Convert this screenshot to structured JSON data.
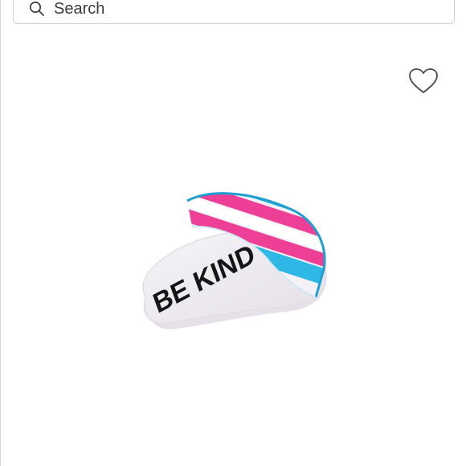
{
  "search": {
    "placeholder": "Search"
  },
  "product": {
    "sole_text": "BE KIND"
  },
  "icons": {
    "search": "search-icon",
    "like": "heart-outline-icon"
  },
  "colors": {
    "stripe_blue": "#2fb7e6",
    "stripe_pink": "#ee3f96",
    "sole": "#f2eff3"
  }
}
